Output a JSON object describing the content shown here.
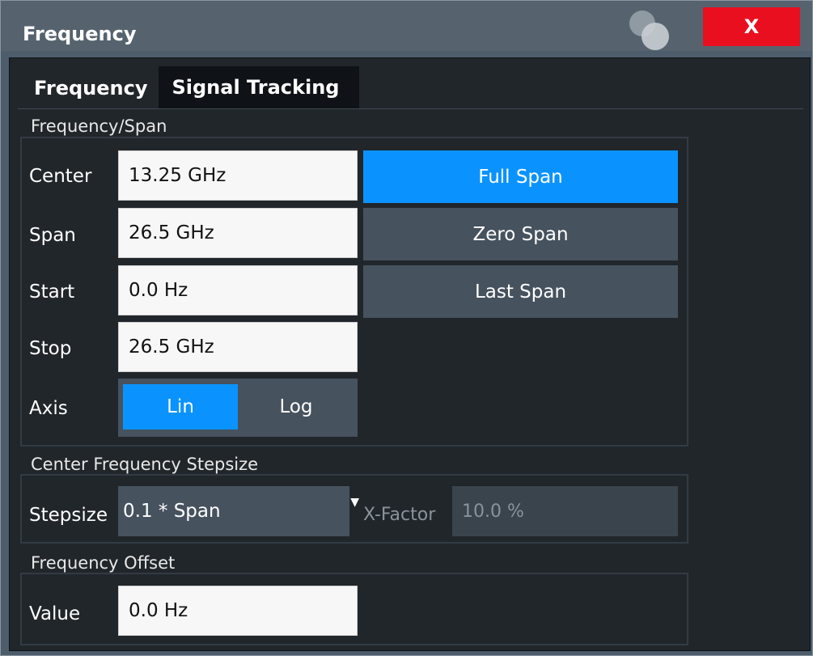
{
  "window": {
    "title": "Frequency",
    "close_label": "X"
  },
  "tabs": [
    {
      "label": "Frequency",
      "active": true
    },
    {
      "label": "Signal Tracking",
      "active": false
    }
  ],
  "freq_span": {
    "group_label": "Frequency/Span",
    "center": {
      "label": "Center",
      "value": "13.25 GHz"
    },
    "span": {
      "label": "Span",
      "value": "26.5 GHz"
    },
    "start": {
      "label": "Start",
      "value": "0.0 Hz"
    },
    "stop": {
      "label": "Stop",
      "value": "26.5 GHz"
    },
    "axis": {
      "label": "Axis",
      "options": [
        "Lin",
        "Log"
      ],
      "selected": "Lin"
    },
    "buttons": {
      "full_span": "Full Span",
      "zero_span": "Zero Span",
      "last_span": "Last Span"
    }
  },
  "stepsize": {
    "group_label": "Center Frequency Stepsize",
    "label": "Stepsize",
    "selected": "0.1 * Span",
    "xfactor_label": "X-Factor",
    "xfactor_value": "10.0 %"
  },
  "offset": {
    "group_label": "Frequency Offset",
    "label": "Value",
    "value": "0.0 Hz"
  },
  "colors": {
    "accent": "#0a93ff",
    "close": "#ea0f1f",
    "panel": "#21262b",
    "button": "#46525e"
  }
}
